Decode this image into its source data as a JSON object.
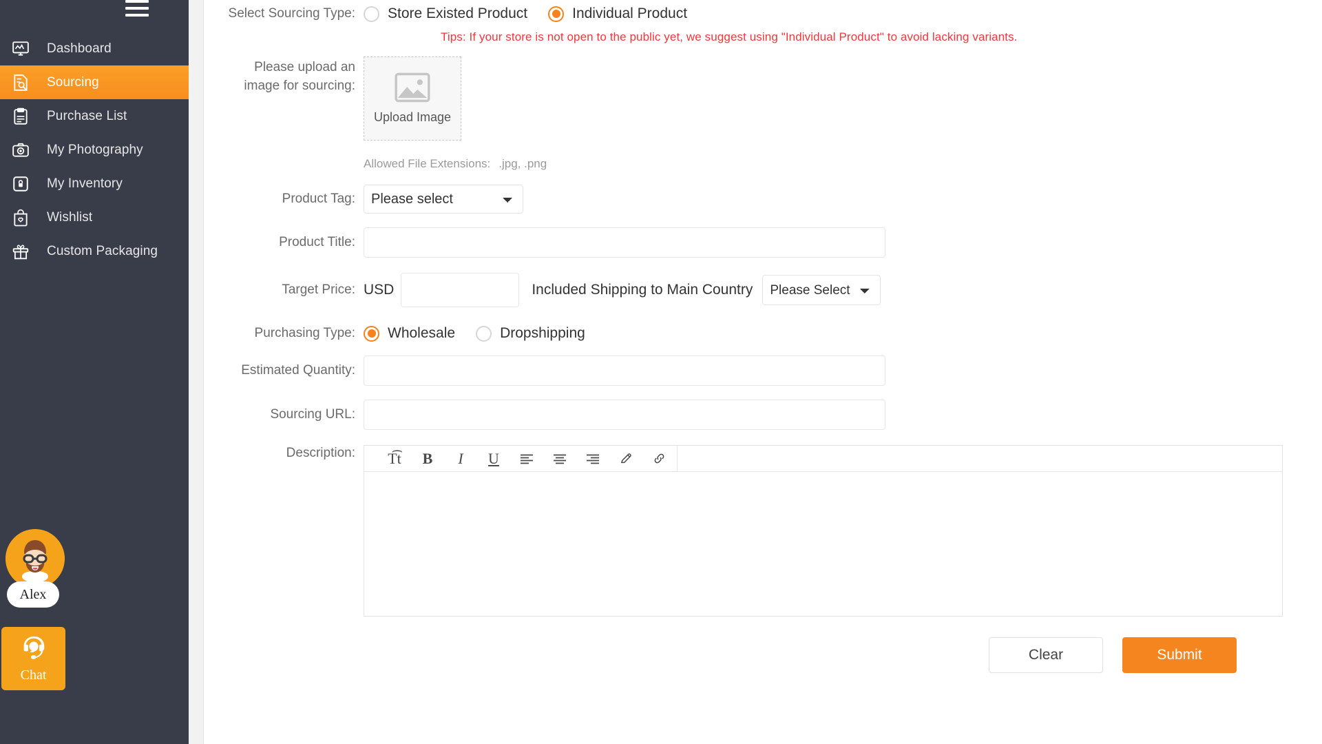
{
  "sidebar": {
    "menu_icon": "hamburger-icon",
    "items": [
      {
        "label": "Dashboard",
        "icon": "dashboard-icon",
        "active": false
      },
      {
        "label": "Sourcing",
        "icon": "sourcing-icon",
        "active": true
      },
      {
        "label": "Purchase List",
        "icon": "clipboard-icon",
        "active": false
      },
      {
        "label": "My Photography",
        "icon": "camera-icon",
        "active": false
      },
      {
        "label": "My Inventory",
        "icon": "lock-box-icon",
        "active": false
      },
      {
        "label": "Wishlist",
        "icon": "heart-bag-icon",
        "active": false
      },
      {
        "label": "Custom Packaging",
        "icon": "gift-icon",
        "active": false
      }
    ],
    "user": {
      "name": "Alex",
      "avatar_icon": "user-avatar"
    },
    "chat": {
      "label": "Chat",
      "icon": "headset-icon"
    },
    "colors": {
      "background": "#393d49",
      "active": "#f78e1e",
      "accent": "#f5a31a"
    }
  },
  "form": {
    "sourcing_type": {
      "label": "Select Sourcing Type:",
      "options": [
        {
          "label": "Store Existed Product",
          "selected": false
        },
        {
          "label": "Individual Product",
          "selected": true
        }
      ]
    },
    "tips": "Tips: If your store is not open to the public yet, we suggest using \"Individual Product\" to avoid lacking variants.",
    "upload": {
      "label_line1": "Please upload an",
      "label_line2": "image for sourcing:",
      "button_text": "Upload Image",
      "icon": "image-placeholder-icon",
      "extensions_note": "Allowed File Extensions:",
      "extensions_value": ".jpg, .png"
    },
    "product_tag": {
      "label": "Product Tag:",
      "value": "Please select",
      "options": [
        "Please select"
      ]
    },
    "product_title": {
      "label": "Product Title:",
      "value": "",
      "placeholder": ""
    },
    "target_price": {
      "label": "Target Price:",
      "currency": "USD",
      "value": "",
      "shipping_label": "Included Shipping to Main Country",
      "country_value": "Please Select",
      "country_options": [
        "Please Select"
      ]
    },
    "purchasing_type": {
      "label": "Purchasing Type:",
      "options": [
        {
          "label": "Wholesale",
          "selected": true
        },
        {
          "label": "Dropshipping",
          "selected": false
        }
      ]
    },
    "estimated_quantity": {
      "label": "Estimated Quantity:",
      "value": "",
      "placeholder": ""
    },
    "sourcing_url": {
      "label": "Sourcing URL:",
      "value": "",
      "placeholder": ""
    },
    "description": {
      "label": "Description:",
      "value": "",
      "toolbar": [
        {
          "glyph": "Tt",
          "name": "font-size-icon"
        },
        {
          "glyph": "B",
          "name": "bold-icon"
        },
        {
          "glyph": "I",
          "name": "italic-icon"
        },
        {
          "glyph": "U",
          "name": "underline-icon"
        },
        {
          "glyph": "",
          "name": "align-left-icon"
        },
        {
          "glyph": "",
          "name": "align-center-icon"
        },
        {
          "glyph": "",
          "name": "align-right-icon"
        },
        {
          "glyph": "",
          "name": "text-color-pencil-icon"
        },
        {
          "glyph": "",
          "name": "link-icon"
        }
      ]
    },
    "actions": {
      "clear": "Clear",
      "submit": "Submit"
    },
    "colors": {
      "tips": "#f0383b",
      "accent": "#f5821f",
      "submit_bg": "#f5861f"
    }
  }
}
